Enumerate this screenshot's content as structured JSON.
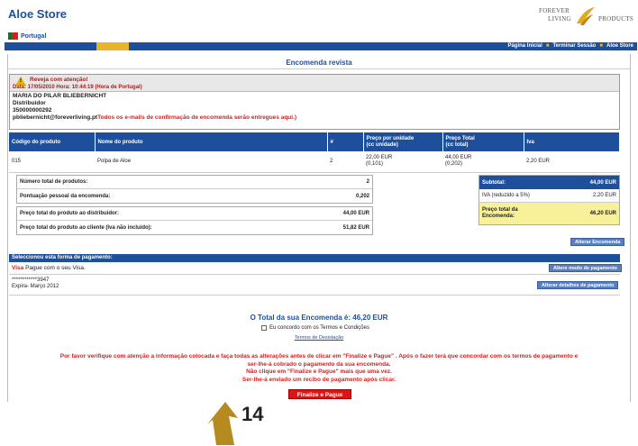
{
  "header": {
    "store_title": "Aloe Store",
    "logo_top": "FOREVER",
    "logo_mid": "LIVING",
    "logo_right": "PRODUCTS",
    "country": "Portugal"
  },
  "nav": {
    "links": [
      "Página Inicial",
      "Terminar Sessão",
      "Aloe Store"
    ]
  },
  "order": {
    "title": "Encomenda revista",
    "warning_title": "Reveja com atenção!",
    "warning_date": "Data: 17/05/2010 Hora: 10:44:19 (Hora de Portugal)",
    "customer_name": "MARIA DO PILAR BLIEBERNICHT",
    "customer_role": "Distribuidor",
    "customer_id": "350000000292",
    "customer_email": "pbliebernicht@foreverliving.pt",
    "email_notice": "Todos os e-mails de confirmação de encomenda serão entregues aqui.)"
  },
  "products_table": {
    "headers": [
      "Código do produto",
      "Nome do produto",
      "#",
      "Preço por unidade\n(cc unidade)",
      "Preço Total\n(cc total)",
      "Iva"
    ],
    "rows": [
      {
        "code": "015",
        "name": "Polpa de Aloe",
        "qty": "2",
        "unit_price": "22,00 EUR",
        "unit_cc": "(0,101)",
        "total_price": "44,00 EUR",
        "total_cc": "(0,202)",
        "iva": "2,20 EUR"
      }
    ]
  },
  "summary_left": {
    "rows1": [
      {
        "label": "Número total de produtos:",
        "value": "2"
      },
      {
        "label": "Pontuação pessoal da encomenda:",
        "value": "0,202"
      }
    ],
    "rows2": [
      {
        "label": "Preço total do produto ao distribuidor:",
        "value": "44,00 EUR"
      },
      {
        "label": "Preço total do produto ao cliente (Iva não incluído):",
        "value": "51,82 EUR"
      }
    ]
  },
  "summary_right": {
    "subtotal_label": "Subtotal:",
    "subtotal_value": "44,00 EUR",
    "iva_label": "IVA (reduzido a 5%)",
    "iva_value": "2,20 EUR",
    "total_label": "Preço total da Encomenda:",
    "total_value": "46,20 EUR"
  },
  "buttons": {
    "alter_order": "Alterar Encomenda",
    "alter_payment_method": "Altere modo de pagamento",
    "alter_payment_details": "Alterar detalhes de pagamento",
    "finalize": "Finalize e Pague"
  },
  "payment": {
    "heading": "Seleccionou esta forma de pagamento:",
    "method": "Visa",
    "method_text": "Pague com o seu Visa.",
    "card_number": "************3947",
    "expiry": "Expira- Março 2012"
  },
  "footer": {
    "grand_total": "O Total da sua Encomenda é: 46,20 EUR",
    "terms_label": "Eu concordo com os Termos e Condições",
    "terms_link": "Termos de Desistação",
    "notice_lines": [
      "Por favor verifique com atenção a informação colocada e faça todas as alterações antes de clicar em \"Finalize e Pague\" . Após o fazer terá que concordar com os termos de pagamento e",
      "ser-lhe-á cobrado o pagamento da sua encomenda.",
      "Não clique em \"Finalize e Pague\" mais que uma vez.",
      "Ser-lhe-á enviado um recibo de pagamento após clicar."
    ]
  },
  "step_marker": "14",
  "colors": {
    "brand_blue": "#1e4f9c",
    "accent_gold": "#e8b42a",
    "alert_red": "#d51e1e",
    "total_highlight": "#f8f19a",
    "arrow_gold": "#b58a1e"
  }
}
